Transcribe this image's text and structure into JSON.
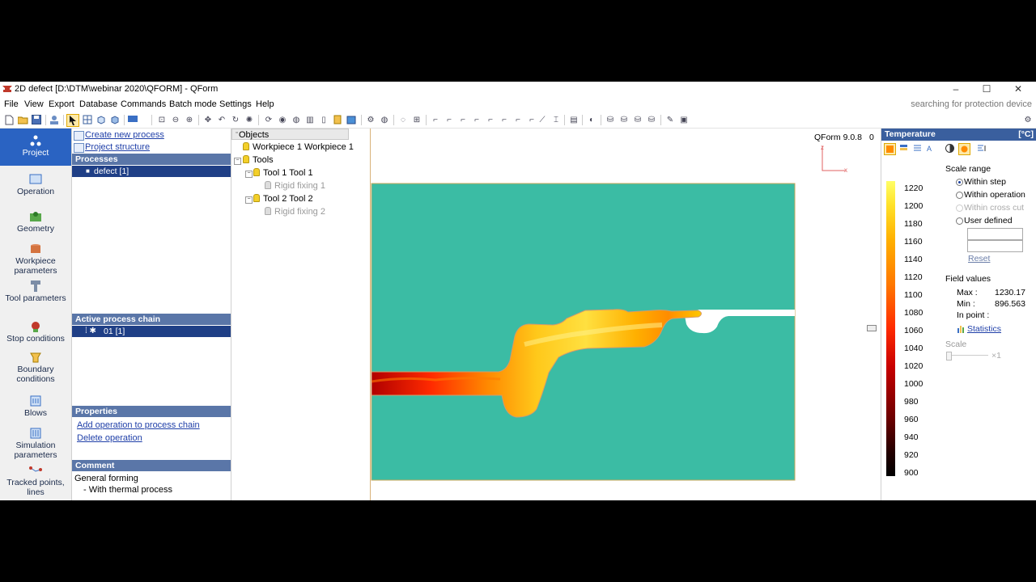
{
  "window": {
    "title": "2D defect  [D:\\DTM\\webinar 2020\\QFORM] - QForm",
    "controls": [
      "–",
      "☐",
      "✕"
    ]
  },
  "menu": {
    "items": [
      "File",
      "View",
      "Export",
      "Database",
      "Commands",
      "Batch mode",
      "Settings",
      "Help"
    ],
    "status": "searching for protection device"
  },
  "nav": {
    "items": [
      {
        "label": "Project",
        "icon": "project-icon"
      },
      {
        "label": "Operation",
        "icon": "operation-icon"
      },
      {
        "label": "Geometry",
        "icon": "geometry-icon"
      },
      {
        "label": "Workpiece parameters",
        "icon": "workpiece-icon"
      },
      {
        "label": "Tool parameters",
        "icon": "tool-icon"
      },
      {
        "label": "Stop conditions",
        "icon": "stop-icon"
      },
      {
        "label": "Boundary conditions",
        "icon": "boundary-icon"
      },
      {
        "label": "Blows",
        "icon": "blows-icon"
      },
      {
        "label": "Simulation parameters",
        "icon": "simulation-icon"
      },
      {
        "label": "Tracked points, lines",
        "icon": "tracked-icon"
      }
    ]
  },
  "project": {
    "links": [
      "Create new process",
      "Project structure"
    ],
    "processes_header": "Processes",
    "process_item": "defect [1]",
    "chain_header": "Active process chain",
    "chain_item": "01 [1]",
    "properties_header": "Properties",
    "properties_links": [
      "Add operation to process chain",
      "Delete operation"
    ],
    "comment_header": "Comment",
    "comment_lines": [
      "General forming",
      "- With thermal process"
    ]
  },
  "tree": {
    "header": "Objects",
    "nodes": [
      {
        "label": "Workpiece 1 Workpiece 1"
      },
      {
        "label": "Tools"
      },
      {
        "label": "Tool 1 Tool 1"
      },
      {
        "label": "Rigid fixing 1"
      },
      {
        "label": "Tool 2 Tool 2"
      },
      {
        "label": "Rigid fixing 2"
      }
    ]
  },
  "viewport": {
    "version": "QForm 9.0.8",
    "step": "0",
    "axis_z": "z",
    "axis_x": "x",
    "die_color": "#3bbca4"
  },
  "field_panel": {
    "title": "Temperature",
    "unit": "[°C]",
    "scale_range_label": "Scale range",
    "options": [
      "Within step",
      "Within operation",
      "Within cross cut",
      "User defined"
    ],
    "selected": 0,
    "reset": "Reset",
    "field_values_label": "Field values",
    "max_label": "Max :",
    "max_value": "1230.17",
    "min_label": "Min :",
    "min_value": "896.563",
    "inpoint_label": "In point :",
    "statistics": "Statistics",
    "scale_label": "Scale",
    "scale_value": "×1",
    "ticks": [
      "1220",
      "1200",
      "1180",
      "1160",
      "1140",
      "1120",
      "1100",
      "1080",
      "1060",
      "1040",
      "1020",
      "1000",
      "980",
      "960",
      "940",
      "920",
      "900"
    ]
  }
}
